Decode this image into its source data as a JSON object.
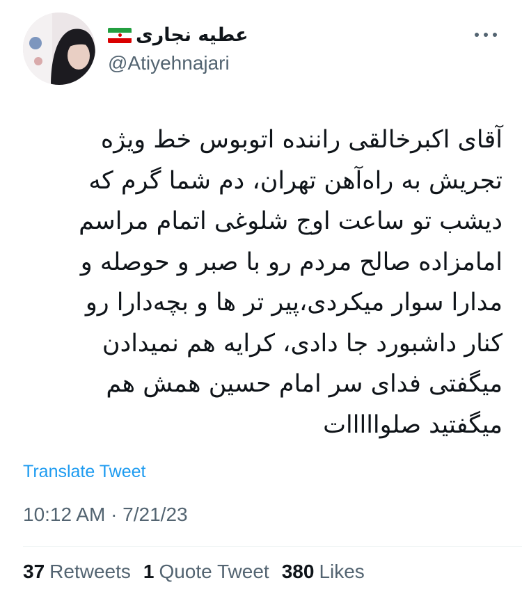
{
  "tweet": {
    "author": {
      "display_name": "عطیه نجاری",
      "handle": "@Atiyehnajari",
      "flag_icon": "iran-flag-icon"
    },
    "text_lines": [
      "آقای اکبرخالقی راننده اتوبوس خط ویژه",
      "تجریش به راه‌آهن تهران، دم شما گرم که",
      "دیشب تو ساعت اوج شلوغی اتمام مراسم",
      "امامزاده صالح مردم رو با صبر و حوصله و",
      "مدارا سوار میکردی،پیر تر ها و بچه‌دارا رو",
      "کنار داشبورد جا دادی، کرایه هم نمیدادن",
      "میگفتی فدای سر امام حسین همش هم",
      "میگفتید صلوااااات"
    ],
    "translate_label": "Translate Tweet",
    "timestamp": "10:12 AM · 7/21/23",
    "stats": {
      "retweets_count": "37",
      "retweets_label": "Retweets",
      "quotes_count": "1",
      "quotes_label": "Quote Tweet",
      "likes_count": "380",
      "likes_label": "Likes"
    }
  },
  "colors": {
    "text_primary": "#0f1419",
    "text_secondary": "#536471",
    "link": "#1d9bf0",
    "divider": "#eff3f4"
  }
}
